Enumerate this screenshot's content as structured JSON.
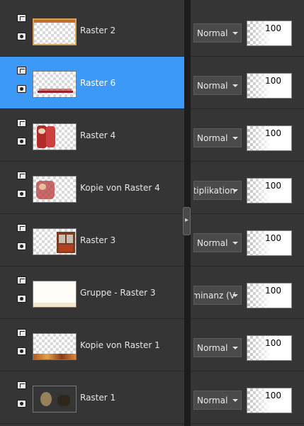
{
  "layers": [
    {
      "name": "Raster 2",
      "selected": false,
      "blend": "Normal",
      "opacity": "100"
    },
    {
      "name": "Raster 6",
      "selected": true,
      "blend": "Normal",
      "opacity": "100"
    },
    {
      "name": "Raster 4",
      "selected": false,
      "blend": "Normal",
      "opacity": "100"
    },
    {
      "name": "Kopie von Raster 4",
      "selected": false,
      "blend": "Multiplikation",
      "opacity": "100"
    },
    {
      "name": "Raster 3",
      "selected": false,
      "blend": "Normal",
      "opacity": "100"
    },
    {
      "name": "Gruppe - Raster 3",
      "selected": false,
      "blend": "Luminanz (V",
      "opacity": "100"
    },
    {
      "name": "Kopie von Raster 1",
      "selected": false,
      "blend": "Normal",
      "opacity": "100"
    },
    {
      "name": "Raster 1",
      "selected": false,
      "blend": "Normal",
      "opacity": "100"
    }
  ],
  "icons": {
    "mask": "layer-mask-icon",
    "visibility": "eye-icon",
    "dropdown": "chevron-down-icon",
    "splitter": "chevron-right-icon"
  },
  "colors": {
    "selected": "#3d99f7",
    "panel": "#353535",
    "divider": "#1c1c1c"
  }
}
